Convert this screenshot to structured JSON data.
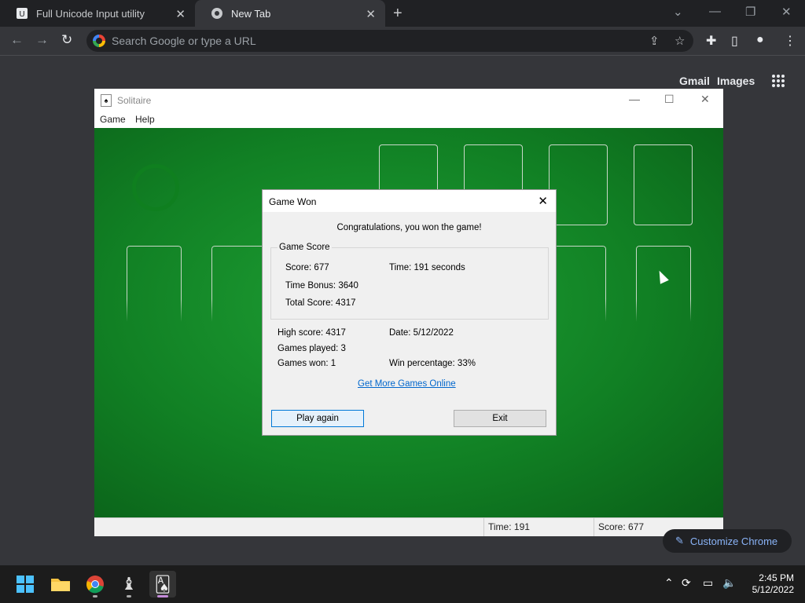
{
  "browser": {
    "tabs": [
      {
        "title": "Full Unicode Input utility",
        "icon": "unicode-input-icon",
        "active": false
      },
      {
        "title": "New Tab",
        "icon": "chrome-icon",
        "active": true
      }
    ],
    "omnibox_placeholder": "Search Google or type a URL",
    "ntp_links": {
      "gmail": "Gmail",
      "images": "Images"
    },
    "customize_label": "Customize Chrome"
  },
  "solitaire": {
    "window_title": "Solitaire",
    "menu": [
      "Game",
      "Help"
    ],
    "status": {
      "time": "Time:  191",
      "score": "Score: 677"
    }
  },
  "dialog": {
    "title": "Game Won",
    "congrats": "Congratulations, you won the game!",
    "group_title": "Game Score",
    "score": "Score: 677",
    "time": "Time:  191 seconds",
    "time_bonus": "Time Bonus: 3640",
    "total_score": "Total Score: 4317",
    "high_score": "High score: 4317",
    "date": "Date: 5/12/2022",
    "games_played": "Games played: 3",
    "games_won": "Games won: 1",
    "win_percentage": "Win percentage: 33%",
    "more_games_link": "Get More Games Online",
    "play_again": "Play again",
    "exit": "Exit"
  },
  "taskbar": {
    "time": "2:45 PM",
    "date": "5/12/2022"
  },
  "colors": {
    "felt": "#118024",
    "chrome_dark": "#202124",
    "accent_link": "#0066cc",
    "customize_text": "#8ab4f8"
  }
}
